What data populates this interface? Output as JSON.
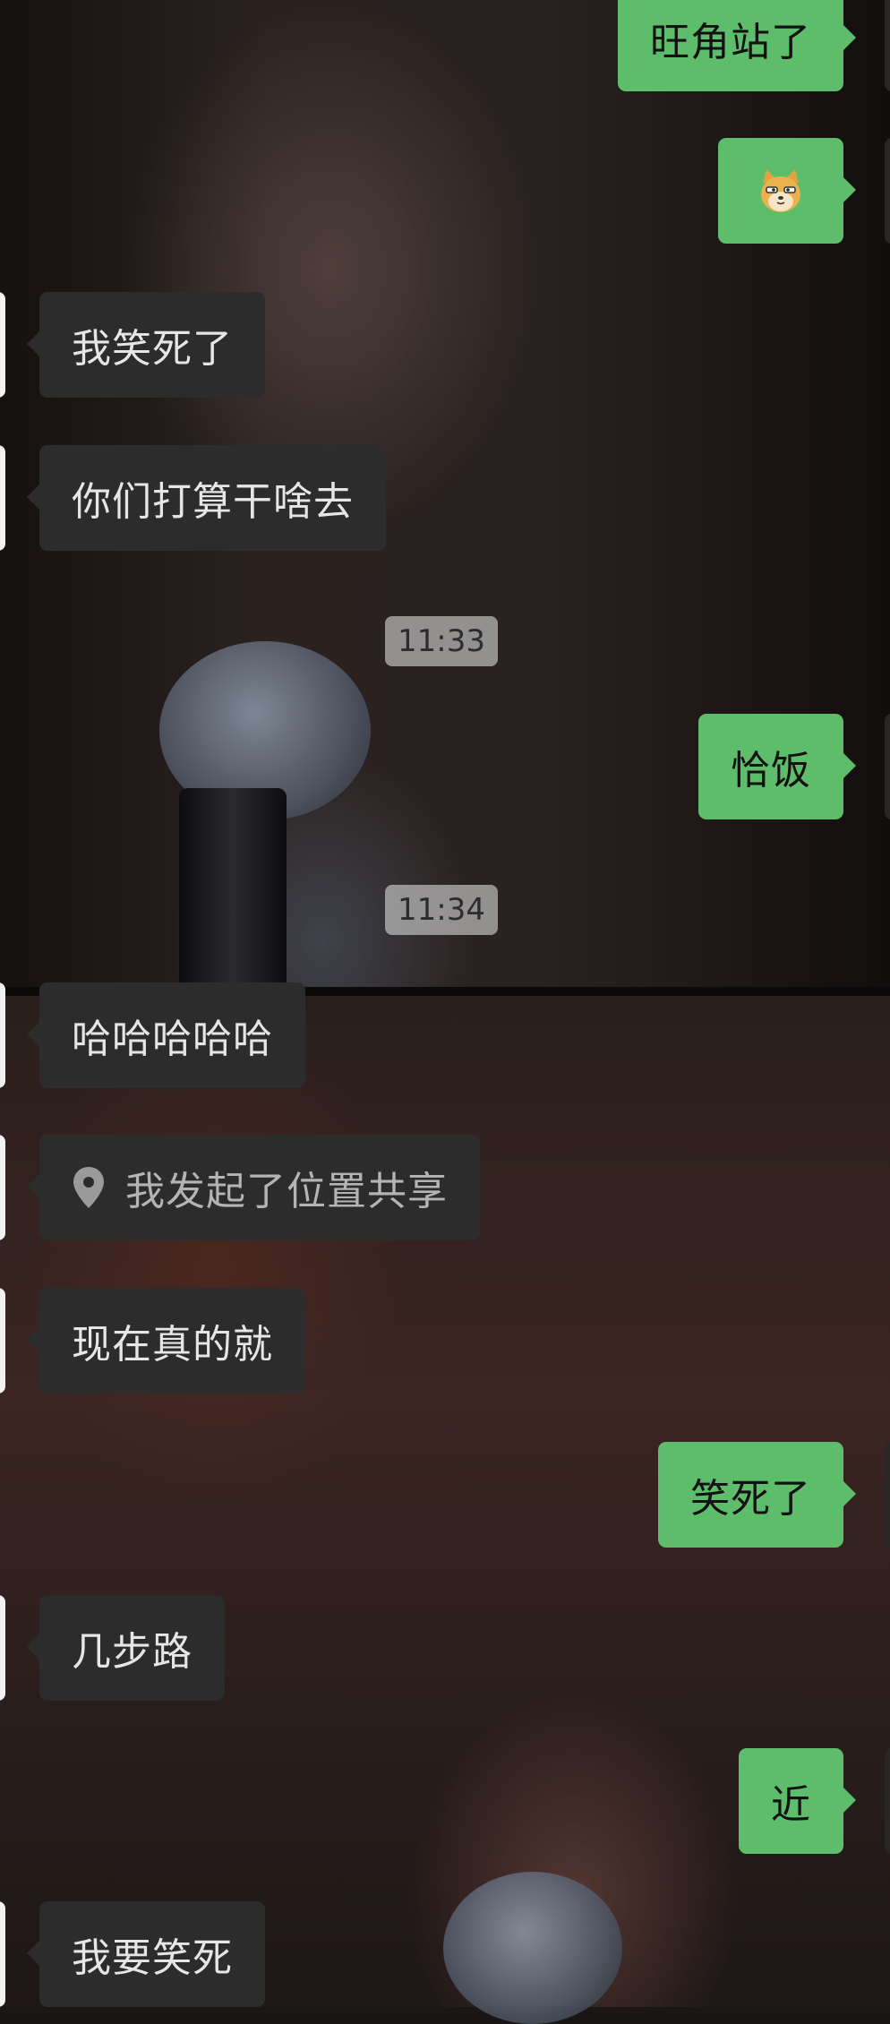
{
  "timestamps": {
    "t1": "11:33",
    "t2": "11:34"
  },
  "messages": {
    "m1": "旺角站了",
    "m3": "我笑死了",
    "m4": "你们打算干啥去",
    "m5": "恰饭",
    "m6": "哈哈哈哈哈",
    "m7": "我发起了位置共享",
    "m8": "现在真的就",
    "m9": "笑死了",
    "m10": "几步路",
    "m11": "近",
    "m12": "我要笑死"
  },
  "icons": {
    "sticker": "doge-emoji-icon",
    "location": "location-pin-icon"
  },
  "colors": {
    "outgoing_bubble": "#5ebd6a",
    "incoming_bubble": "#2c2c2c",
    "timestamp_bg": "#cdcdcd"
  }
}
